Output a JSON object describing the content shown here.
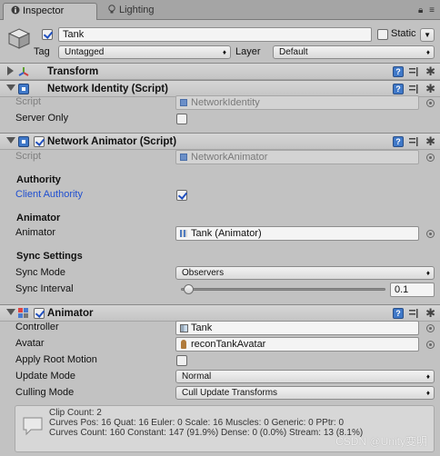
{
  "tabs": {
    "inspector": "Inspector",
    "lighting": "Lighting"
  },
  "tab_icons": {
    "lock": "lock-icon",
    "menu": "menu-icon"
  },
  "header": {
    "object_name": "Tank",
    "static_label": "Static",
    "tag_label": "Tag",
    "tag_value": "Untagged",
    "layer_label": "Layer",
    "layer_value": "Default"
  },
  "transform": {
    "title": "Transform"
  },
  "network_identity": {
    "title": "Network Identity (Script)",
    "script_label": "Script",
    "script_value": "NetworkIdentity",
    "server_only_label": "Server Only"
  },
  "network_animator": {
    "title": "Network Animator (Script)",
    "script_label": "Script",
    "script_value": "NetworkAnimator",
    "authority_header": "Authority",
    "client_authority_label": "Client Authority",
    "animator_header": "Animator",
    "animator_label": "Animator",
    "animator_value": "Tank (Animator)",
    "sync_header": "Sync Settings",
    "sync_mode_label": "Sync Mode",
    "sync_mode_value": "Observers",
    "sync_interval_label": "Sync Interval",
    "sync_interval_value": "0.1",
    "sync_interval_slider_fraction": 0.02
  },
  "animator": {
    "title": "Animator",
    "controller_label": "Controller",
    "controller_value": "Tank",
    "avatar_label": "Avatar",
    "avatar_value": "reconTankAvatar",
    "apply_root_motion_label": "Apply Root Motion",
    "update_mode_label": "Update Mode",
    "update_mode_value": "Normal",
    "culling_mode_label": "Culling Mode",
    "culling_mode_value": "Cull Update Transforms",
    "info_lines": [
      "Clip Count: 2",
      "Curves Pos: 16 Quat: 16 Euler: 0 Scale: 16 Muscles: 0 Generic: 0 PPtr: 0",
      "Curves Count: 160 Constant: 147 (91.9%) Dense: 0 (0.0%) Stream: 13 (8.1%)"
    ]
  },
  "watermark": "CSDN @Unity变明",
  "colors": {
    "accent_blue": "#1f4fd0",
    "panel_bg": "#c2c2c2",
    "help_blue": "#3f78c8"
  }
}
